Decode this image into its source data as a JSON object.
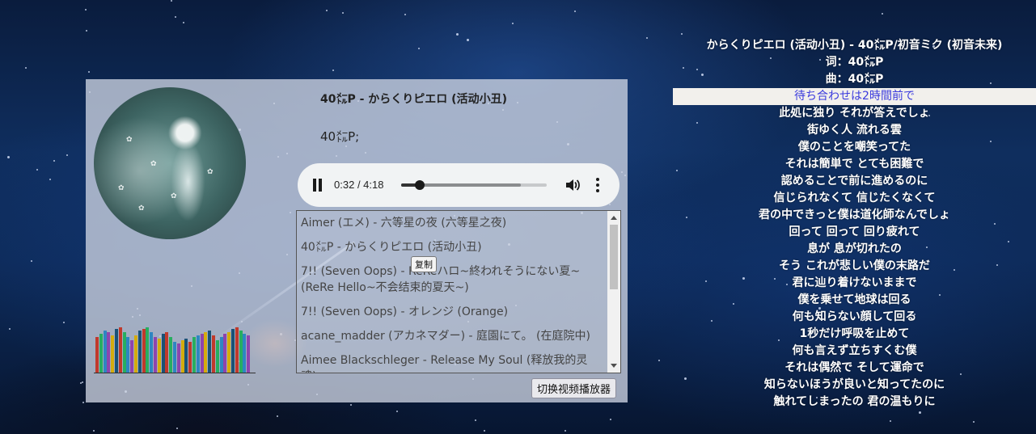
{
  "player": {
    "song_title": "40㍍P - からくりピエロ (活动小丑)",
    "artist": "40㍍P;",
    "audio": {
      "current_time": "0:32",
      "duration": "4:18",
      "progress_fraction": 0.13,
      "buffered_fraction": 0.82
    },
    "playlist": [
      "Aimer (エメ) - 六等星の夜 (六等星之夜)",
      "40㍍P - からくりピエロ (活动小丑)",
      "7!! (Seven Oops) - ReReハロ~終われそうにない夏~ (ReRe Hello~不会结束的夏天~)",
      "7!! (Seven Oops) - オレンジ (Orange)",
      "acane_madder (アカネマダー) - 庭園にて。 (在庭院中)",
      "Aimee Blackschleger - Release My Soul (释放我的灵魂)"
    ],
    "copy_tooltip": "复制",
    "switch_button": "切换视频播放器",
    "visualizer_colors": [
      "#c0392b",
      "#27ae60",
      "#2e86c1",
      "#8e44ad",
      "#d4ac0d",
      "#1a5276"
    ]
  },
  "lyrics": {
    "active_index": 3,
    "lines": [
      "からくりピエロ (活动小丑) - 40㍍P/初音ミク (初音未来)",
      "词：40㍍P",
      "曲：40㍍P",
      "待ち合わせは2時間前で",
      "此処に独り それが答えでしょ",
      "街ゆく人 流れる雲",
      "僕のことを嘲笑ってた",
      "それは簡単で とても困難で",
      "認めることで前に進めるのに",
      "信じられなくて 信じたくなくて",
      "君の中できっと僕は道化師なんでしょ",
      "回って 回って 回り疲れて",
      "息が 息が切れたの",
      "そう これが悲しい僕の末路だ",
      "君に辿り着けないままで",
      "僕を乗せて地球は回る",
      "何も知らない顔して回る",
      "1秒だけ呼吸を止めて",
      "何も言えず立ちすくむ僕",
      "それは偶然で そして運命で",
      "知らないほうが良いと知ってたのに",
      "触れてしまったの 君の温もりに"
    ]
  }
}
